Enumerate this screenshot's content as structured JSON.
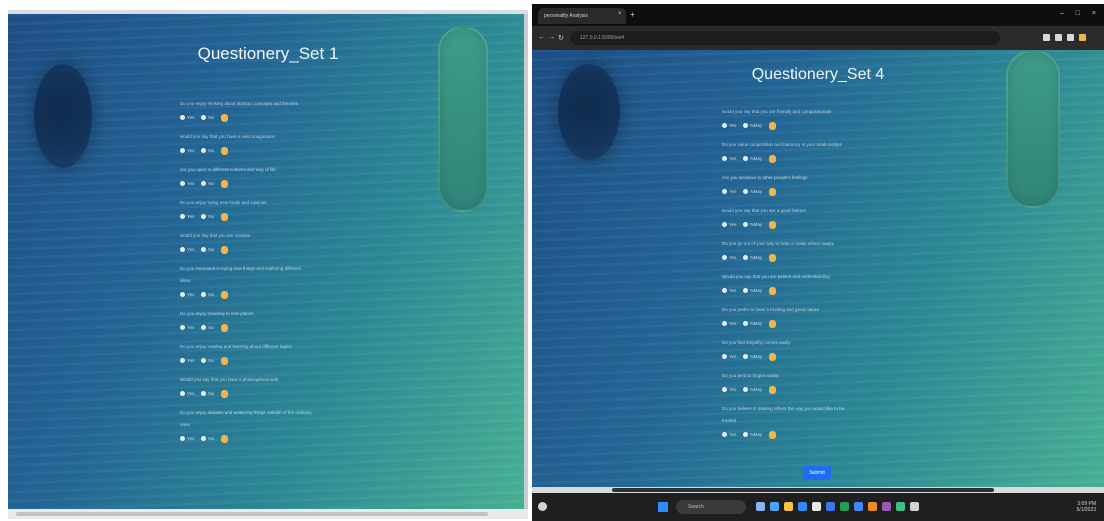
{
  "left": {
    "title": "Questionery_Set 1",
    "questions": [
      "Do you enjoy thinking about abstract concepts and theories",
      "would you say that you have a vivid imagination",
      "are you open to different cultures and way of life",
      "Do you enjoy trying new foods and cuisines",
      "would you say that you are creative",
      "Do you interested in trying new things and exploring different",
      "Do you enjoy traveling to new places",
      "Do you enjoy reading and learning about different topics",
      "Would you say that you have a philosophical side",
      "Do you enjoy debates and analyzing things outside of the ordinary"
    ],
    "wrap": [
      "ideas",
      "ones"
    ],
    "option_yes": "Yes",
    "option_no": "No"
  },
  "right": {
    "title": "Questionery_Set 4",
    "tab_label": "personality Analysis",
    "url": "127.0.0.1:5000/set4",
    "questions": [
      "would you say that you are friendly and compassionate",
      "Do you value cooperation and harmony in your relationships",
      "Are you sensitive to other people's feelings",
      "would you say that you are a good listener",
      "Do you go out of your way to help or make others happy",
      "Would you say that you are patient and understanding",
      "Do you prefer to have a trusting and good nature",
      "Do you find empathy comes easily",
      "Do you tend to forgive easily",
      "Do you believe in treating others the way you would like to be"
    ],
    "wrap": "treated",
    "option_yes": "Yes",
    "option_no": "NMay",
    "submit_label": "Submit",
    "taskbar_search": "Search",
    "tray_time": "3:09 PM",
    "tray_date": "5/1/2023"
  },
  "colors": {
    "accent": "#1e6cf2",
    "wood_start": "#1e4f86",
    "wood_end": "#49b295"
  }
}
